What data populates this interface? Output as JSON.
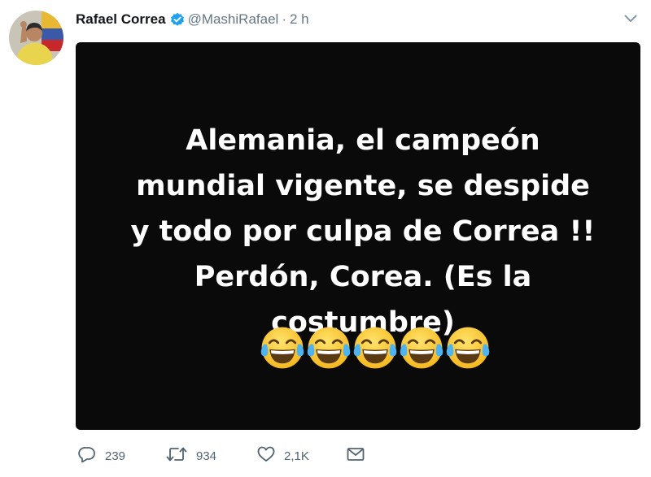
{
  "tweet": {
    "author_name": "Rafael Correa",
    "handle": "@MashiRafael",
    "separator": "·",
    "time": "2 h",
    "media_text": "Alemania, el campeón mundial vigente, se despide y todo por culpa de Correa !! Perdón, Corea. (Es la costumbre)",
    "emoji_count": 5,
    "emoji_name": "face-with-tears-of-joy"
  },
  "actions": {
    "reply_count": "239",
    "retweet_count": "934",
    "like_count": "2,1K"
  },
  "colors": {
    "verified_blue": "#1da1f2",
    "secondary_text": "#657786",
    "media_background": "#0a0a0a"
  }
}
